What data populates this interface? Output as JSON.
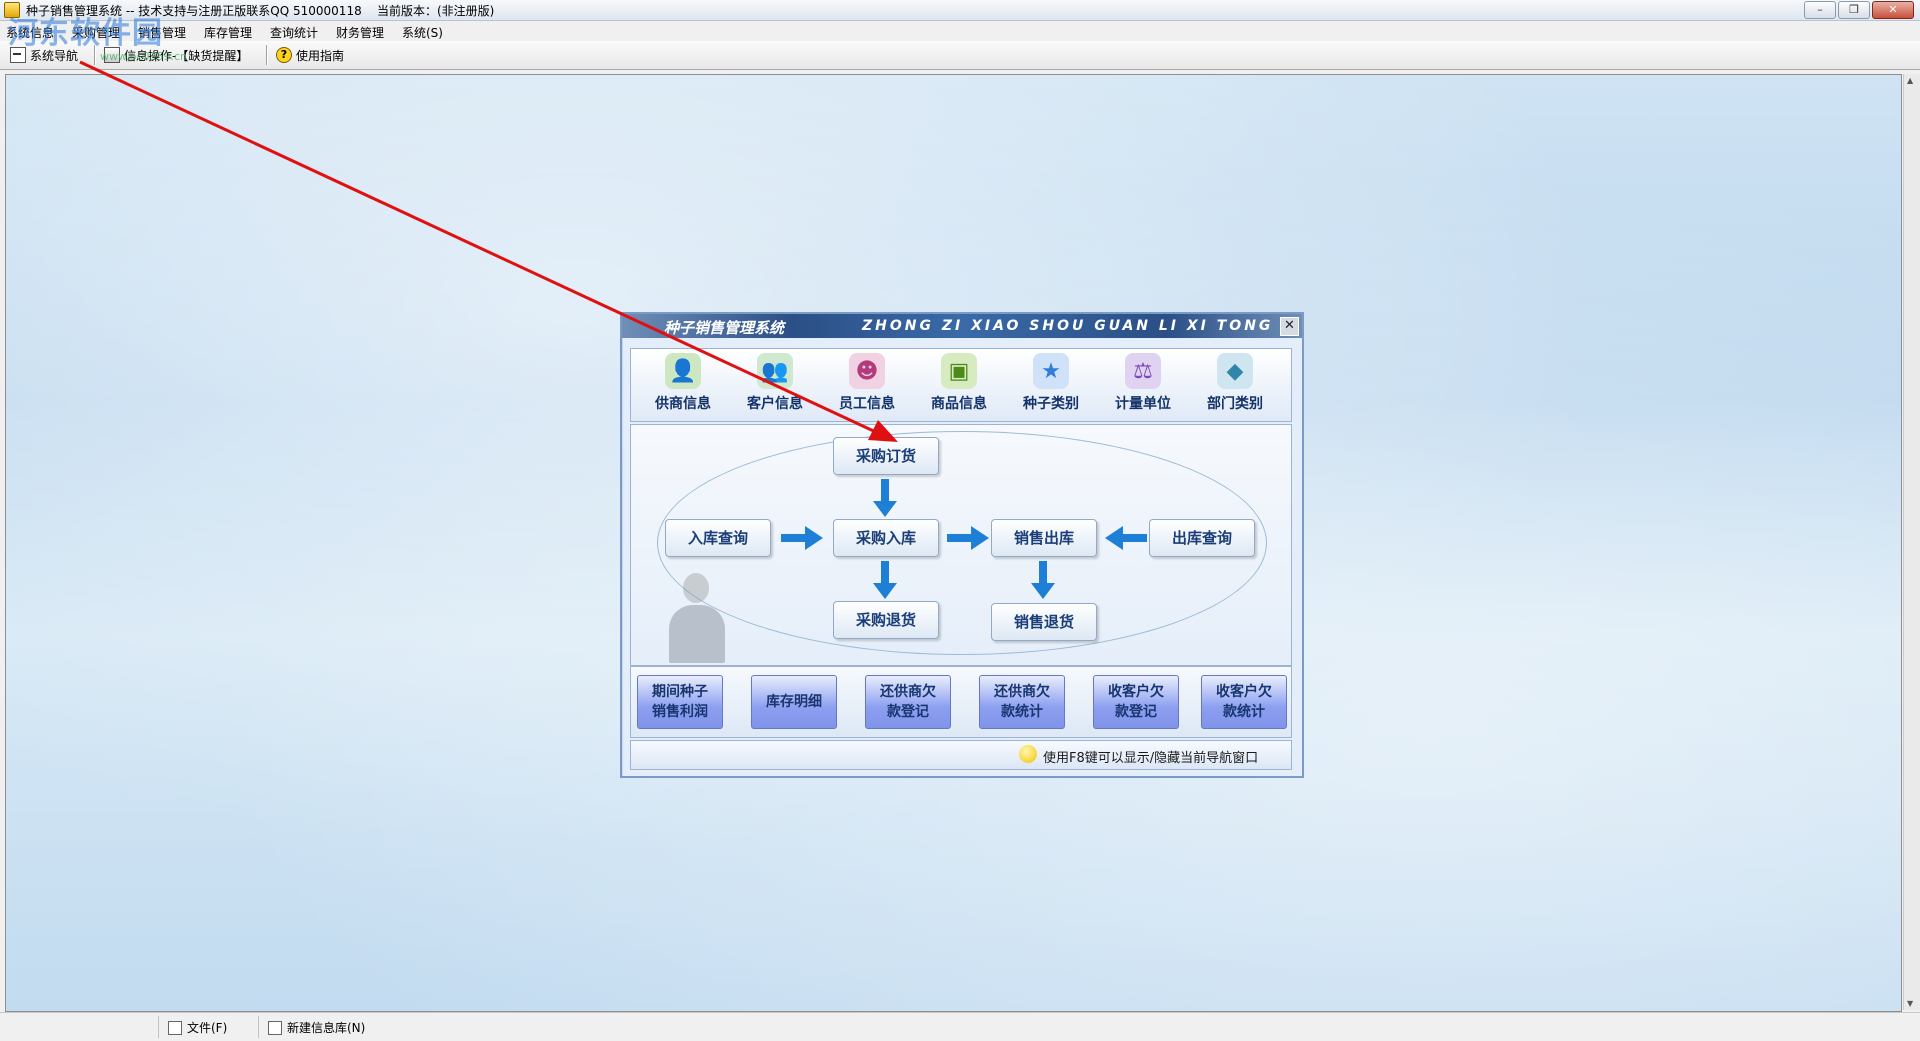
{
  "window": {
    "title": "种子销售管理系统 -- 技术支持与注册正版联系QQ 510000118    当前版本：(非注册版)",
    "controls": {
      "minimize": "–",
      "restore": "❐",
      "close": "✕"
    }
  },
  "menu": [
    "系统信息",
    "采购管理",
    "销售管理",
    "库存管理",
    "查询统计",
    "财务管理",
    "系统(S)"
  ],
  "toolbar": {
    "nav_label": "系统导航",
    "info_label": "信息操作-【缺货提醒】",
    "help_label": "使用指南"
  },
  "watermark": {
    "text": "河东软件园",
    "sub": "www.pc0359.cn"
  },
  "dialog": {
    "title_cn": "种子销售管理系统",
    "title_en": "ZHONG ZI XIAO SHOU GUAN LI XI TONG",
    "close": "✕",
    "icons": [
      {
        "label": "供商信息",
        "icon": "supplier-icon",
        "color": "#4a9a2a"
      },
      {
        "label": "客户信息",
        "icon": "customer-icon",
        "color": "#3a8c3a"
      },
      {
        "label": "员工信息",
        "icon": "staff-icon",
        "color": "#c44a8a"
      },
      {
        "label": "商品信息",
        "icon": "goods-icon",
        "color": "#5a9a1f"
      },
      {
        "label": "种子类别",
        "icon": "star-icon",
        "color": "#2f7fd8"
      },
      {
        "label": "计量单位",
        "icon": "measure-icon",
        "color": "#8a5ac8"
      },
      {
        "label": "部门类别",
        "icon": "department-icon",
        "color": "#3a8fb8"
      }
    ],
    "flow": {
      "purchase_order": "采购订货",
      "stock_in_query": "入库查询",
      "purchase_in": "采购入库",
      "sales_out": "销售出库",
      "stock_out_query": "出库查询",
      "purchase_return": "采购退货",
      "sales_return": "销售退货"
    },
    "bottom_buttons": [
      [
        "期间种子",
        "销售利润"
      ],
      [
        "库存明细"
      ],
      [
        "还供商欠",
        "款登记"
      ],
      [
        "还供商欠",
        "款统计"
      ],
      [
        "收客户欠",
        "款登记"
      ],
      [
        "收客户欠",
        "款统计"
      ]
    ],
    "hint": "使用F8键可以显示/隐藏当前导航窗口"
  },
  "statusbar": {
    "file_label": "文件(F)",
    "newdb_label": "新建信息库(N)"
  },
  "colors": {
    "accent": "#2b4f86",
    "arrow": "#e01010",
    "flow_arrow": "#1d7fd6"
  }
}
